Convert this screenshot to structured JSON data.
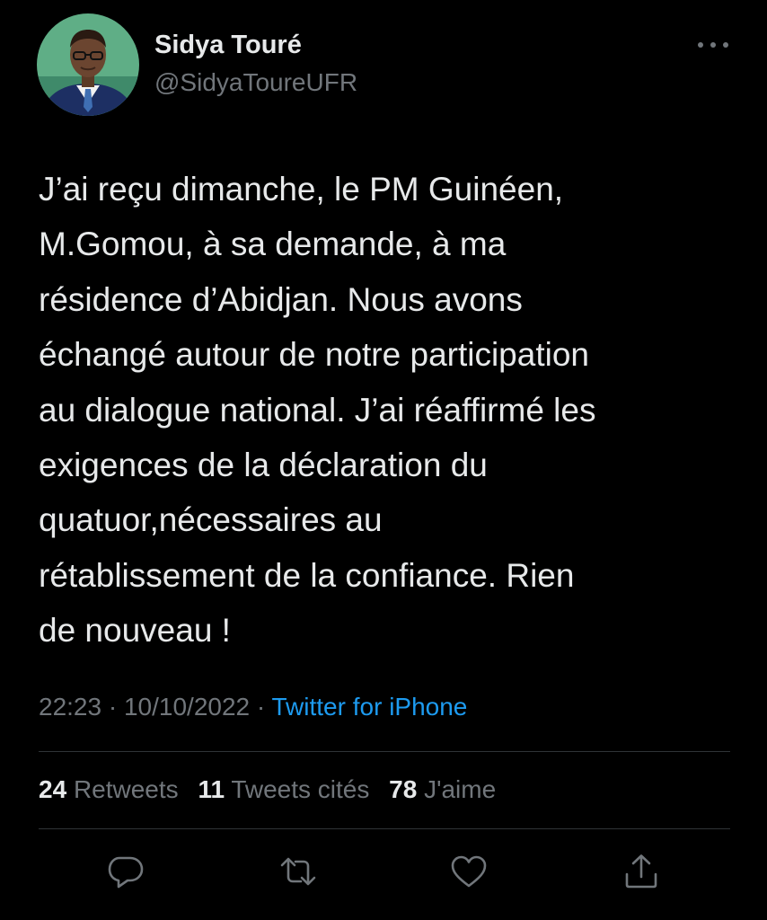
{
  "author": {
    "display_name": "Sidya Touré",
    "handle": "@SidyaToureUFR",
    "avatar_icon": "profile-photo"
  },
  "tweet": {
    "text_lines": [
      "J’ai reçu dimanche, le PM Guinéen,",
      "M.Gomou, à sa demande, à ma",
      "résidence d’Abidjan. Nous avons",
      "échangé autour de notre participation",
      "au dialogue national. J’ai réaffirmé les",
      "exigences de la déclaration du",
      "quatuor,nécessaires au",
      "rétablissement de la confiance. Rien",
      "de nouveau !"
    ],
    "time": "22:23",
    "separator": " · ",
    "date": "10/10/2022",
    "source": "Twitter for iPhone"
  },
  "stats": {
    "retweets_count": "24",
    "retweets_label": "Retweets",
    "quotes_count": "11",
    "quotes_label": "Tweets cités",
    "likes_count": "78",
    "likes_label": "J'aime"
  },
  "actions": {
    "reply_icon": "reply-icon",
    "retweet_icon": "retweet-icon",
    "like_icon": "heart-icon",
    "share_icon": "share-icon",
    "more_icon": "more-icon"
  },
  "colors": {
    "background": "#000000",
    "text": "#e7e9ea",
    "secondary": "#71767b",
    "link": "#1d9bf0",
    "divider": "#2f3336"
  }
}
